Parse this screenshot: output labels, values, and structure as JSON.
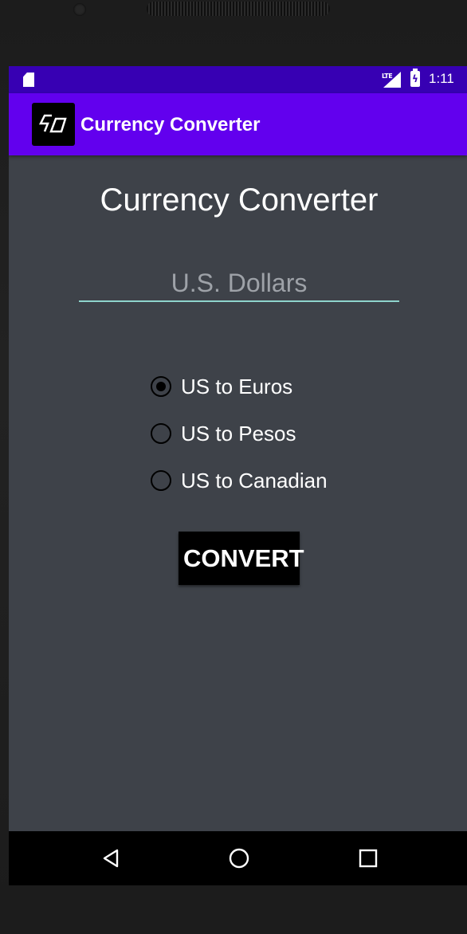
{
  "status_bar": {
    "network": "LTE",
    "time": "1:11",
    "icons": [
      "sd-card-icon",
      "lte-signal-icon",
      "battery-charging-icon"
    ]
  },
  "app_bar": {
    "title": "Currency Converter",
    "logo_icon": "currency-converter-logo",
    "background": "#6200ee"
  },
  "main": {
    "heading": "Currency Converter",
    "amount_input": {
      "value": "",
      "placeholder": "U.S. Dollars"
    },
    "conversion_options": [
      {
        "label": "US to Euros",
        "selected": true
      },
      {
        "label": "US to Pesos",
        "selected": false
      },
      {
        "label": "US to Canadian",
        "selected": false
      }
    ],
    "convert_label": "CONVERT"
  },
  "nav_bar": {
    "icons": [
      "back-icon",
      "home-icon",
      "recents-icon"
    ]
  },
  "colors": {
    "status_bar": "#3700b3",
    "app_bar": "#6200ee",
    "background": "#3e4249",
    "input_underline": "#8fd4cc"
  }
}
